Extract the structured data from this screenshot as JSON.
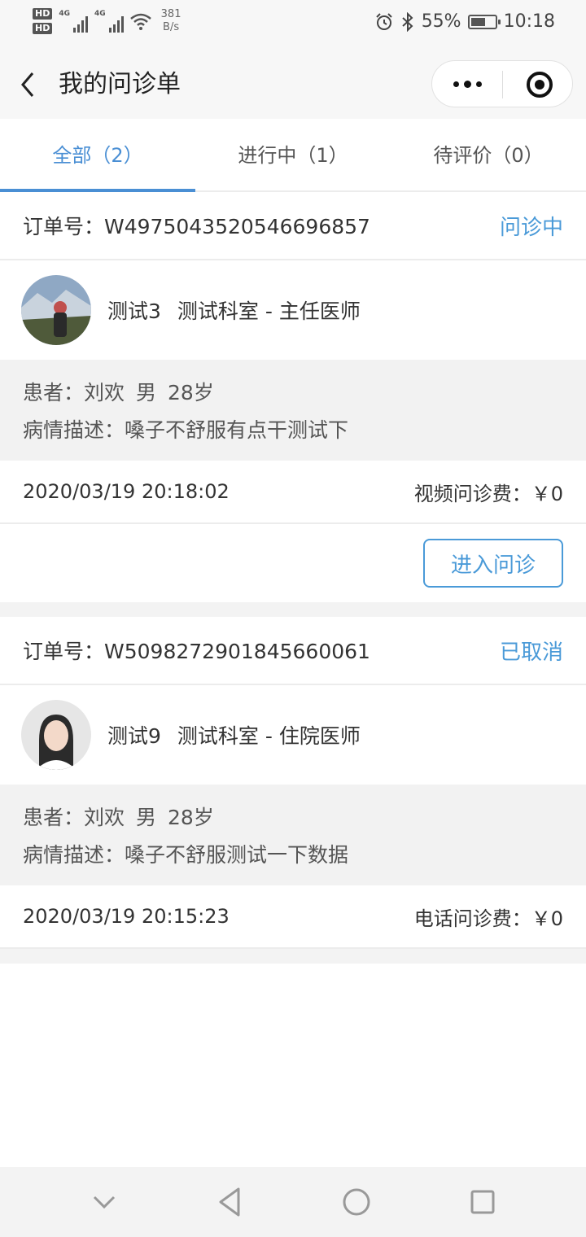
{
  "status_bar": {
    "hd1": "HD",
    "hd2": "HD",
    "net_type_1": "4G",
    "net_type_2": "4G",
    "net_speed_value": "381",
    "net_speed_unit": "B/s",
    "battery": "55%",
    "time": "10:18"
  },
  "header": {
    "title": "我的问诊单"
  },
  "tabs": [
    {
      "label": "全部（2）"
    },
    {
      "label": "进行中（1）"
    },
    {
      "label": "待评价（0）"
    }
  ],
  "orders": [
    {
      "order_label": "订单号：",
      "order_no": "W4975043520546696857",
      "status": "问诊中",
      "doctor_name": "测试3",
      "doctor_dept": "测试科室 - 主任医师",
      "patient": "患者：刘欢",
      "gender": "男",
      "age": "28岁",
      "description": "病情描述：嗓子不舒服有点干测试下",
      "time": "2020/03/19 20:18:02",
      "fee": "视频问诊费：￥0",
      "action_label": "进入问诊"
    },
    {
      "order_label": "订单号：",
      "order_no": "W5098272901845660061",
      "status": "已取消",
      "doctor_name": "测试9",
      "doctor_dept": "测试科室 - 住院医师",
      "patient": "患者：刘欢",
      "gender": "男",
      "age": "28岁",
      "description": "病情描述：嗓子不舒服测试一下数据",
      "time": "2020/03/19 20:15:23",
      "fee": "电话问诊费：￥0"
    }
  ],
  "colors": {
    "accent": "#4a8fd4",
    "status_blue": "#4a9ad8",
    "panel_gray": "#f2f2f2"
  }
}
